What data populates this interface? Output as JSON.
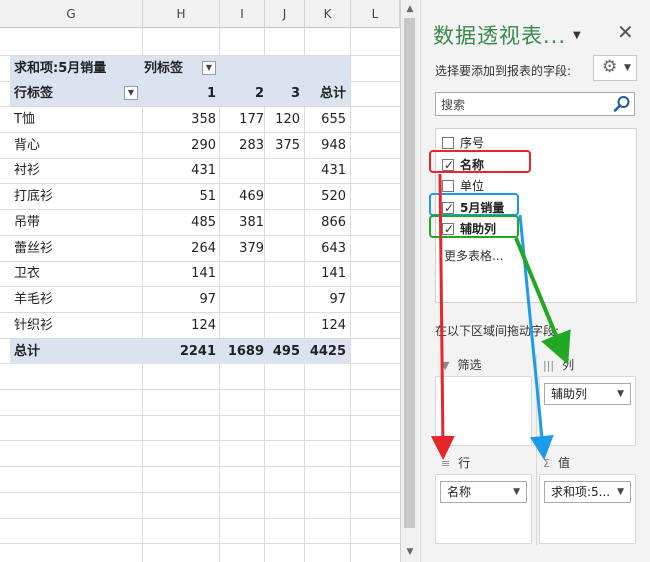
{
  "columns": [
    "G",
    "H",
    "I",
    "J",
    "K",
    "L"
  ],
  "pivot": {
    "value_label": "求和项:5月销量",
    "column_labels_label": "列标签",
    "row_labels_label": "行标签",
    "col_headers": [
      "1",
      "2",
      "3",
      "总计"
    ],
    "rows": [
      {
        "name": "T恤",
        "c1": "358",
        "c2": "177",
        "c3": "120",
        "total": "655"
      },
      {
        "name": "背心",
        "c1": "290",
        "c2": "283",
        "c3": "375",
        "total": "948"
      },
      {
        "name": "衬衫",
        "c1": "431",
        "c2": "",
        "c3": "",
        "total": "431"
      },
      {
        "name": "打底衫",
        "c1": "51",
        "c2": "469",
        "c3": "",
        "total": "520"
      },
      {
        "name": "吊带",
        "c1": "485",
        "c2": "381",
        "c3": "",
        "total": "866"
      },
      {
        "name": "蕾丝衫",
        "c1": "264",
        "c2": "379",
        "c3": "",
        "total": "643"
      },
      {
        "name": "卫衣",
        "c1": "141",
        "c2": "",
        "c3": "",
        "total": "141"
      },
      {
        "name": "羊毛衫",
        "c1": "97",
        "c2": "",
        "c3": "",
        "total": "97"
      },
      {
        "name": "针织衫",
        "c1": "124",
        "c2": "",
        "c3": "",
        "total": "124"
      }
    ],
    "grand_total": {
      "name": "总计",
      "c1": "2241",
      "c2": "1689",
      "c3": "495",
      "total": "4425"
    }
  },
  "pane": {
    "title": "数据透视表...",
    "choose_label": "选择要添加到报表的字段:",
    "search_placeholder": "搜索",
    "fields": [
      {
        "name": "序号",
        "checked": false
      },
      {
        "name": "名称",
        "checked": true
      },
      {
        "name": "单位",
        "checked": false
      },
      {
        "name": "5月销量",
        "checked": true
      },
      {
        "name": "辅助列",
        "checked": true
      }
    ],
    "more_tables": "更多表格...",
    "drag_label": "在以下区域间拖动字段:",
    "areas": {
      "filter": {
        "label": "筛选"
      },
      "columns": {
        "label": "列",
        "chip": "辅助列"
      },
      "rows": {
        "label": "行",
        "chip": "名称"
      },
      "values": {
        "label": "值",
        "chip": "求和项:5..."
      }
    }
  },
  "colors": {
    "title_green": "#3a8a4a",
    "band_blue": "#dce3f0",
    "red": "#e8262a",
    "blue": "#1e9be8",
    "green": "#22a822"
  }
}
